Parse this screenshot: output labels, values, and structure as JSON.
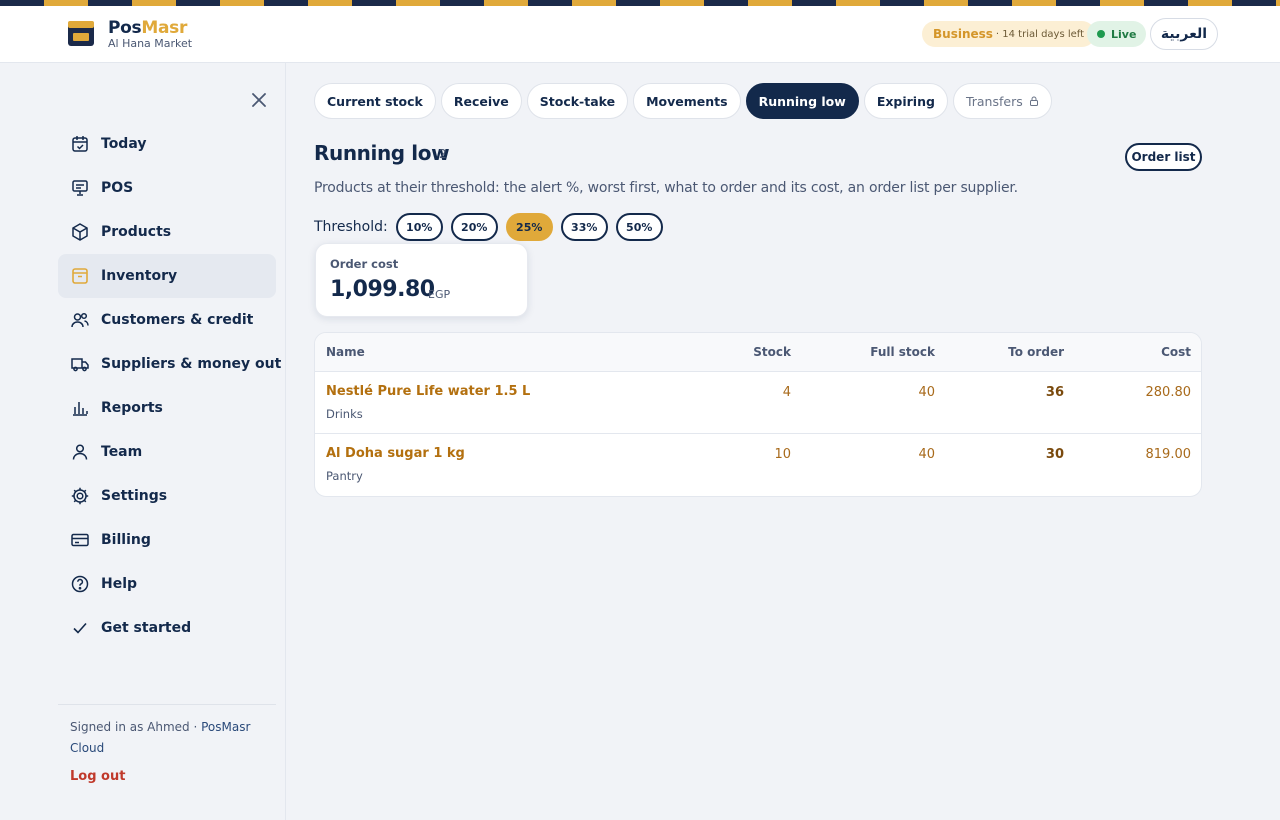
{
  "brand": {
    "name_part1": "Pos",
    "name_part2": "Masr",
    "store": "Al Hana Market"
  },
  "header": {
    "plan": "Business",
    "trial": "· 14 trial days left",
    "status": "Live",
    "language": "العربية"
  },
  "sidebar": {
    "items": [
      {
        "label": "Today",
        "icon": "calendar-check-icon"
      },
      {
        "label": "POS",
        "icon": "monitor-icon"
      },
      {
        "label": "Products",
        "icon": "box-icon"
      },
      {
        "label": "Inventory",
        "icon": "inventory-icon"
      },
      {
        "label": "Customers & credit",
        "icon": "users-icon"
      },
      {
        "label": "Suppliers & money out",
        "icon": "truck-icon"
      },
      {
        "label": "Reports",
        "icon": "bar-chart-icon"
      },
      {
        "label": "Team",
        "icon": "user-icon"
      },
      {
        "label": "Settings",
        "icon": "gear-icon"
      },
      {
        "label": "Billing",
        "icon": "credit-card-icon"
      },
      {
        "label": "Help",
        "icon": "help-circle-icon"
      },
      {
        "label": "Get started",
        "icon": "check-icon"
      }
    ],
    "signed_in_prefix": "Signed in as Ahmed · ",
    "signed_in_link": "PosMasr Cloud",
    "logout": "Log out"
  },
  "tabs": [
    {
      "label": "Current stock"
    },
    {
      "label": "Receive"
    },
    {
      "label": "Stock-take"
    },
    {
      "label": "Movements"
    },
    {
      "label": "Running low"
    },
    {
      "label": "Expiring"
    },
    {
      "label": "Transfers"
    }
  ],
  "page": {
    "title": "Running low",
    "count": "2",
    "order_list_button": "Order list",
    "description": "Products at their threshold: the alert %, worst first, what to order and its cost, an order list per supplier.",
    "threshold_label": "Threshold:",
    "thresholds": [
      "10%",
      "20%",
      "25%",
      "33%",
      "50%"
    ],
    "selected_threshold": "25%",
    "order_cost_label": "Order cost",
    "order_cost_value": "1,099.80",
    "order_cost_unit": "EGP"
  },
  "table": {
    "headers": {
      "name": "Name",
      "stock": "Stock",
      "full": "Full stock",
      "order": "To order",
      "cost": "Cost"
    },
    "rows": [
      {
        "name": "Nestlé Pure Life water 1.5 L",
        "category": "Drinks",
        "stock": "4",
        "full": "40",
        "order": "36",
        "cost": "280.80"
      },
      {
        "name": "Al Doha sugar 1 kg",
        "category": "Pantry",
        "stock": "10",
        "full": "40",
        "order": "30",
        "cost": "819.00"
      }
    ]
  },
  "colors": {
    "navy": "#13294b",
    "gold": "#e0a93a",
    "live_green": "#1f9a4f",
    "logout_red": "#c0392b"
  }
}
